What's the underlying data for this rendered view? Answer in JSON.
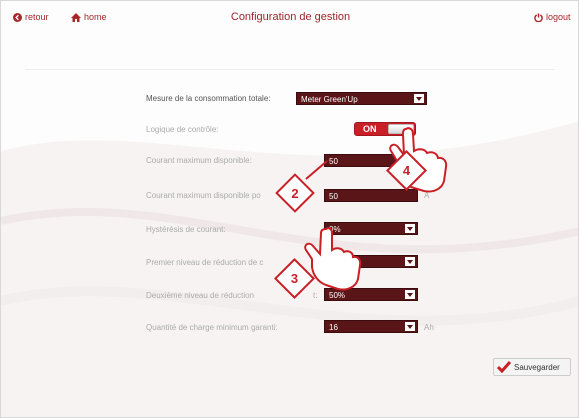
{
  "header": {
    "back_label": "retour",
    "home_label": "home",
    "title": "Configuration de gestion",
    "logout_label": "logout"
  },
  "form": {
    "rows": [
      {
        "label": "Mesure de la consommation totale:",
        "value": "Meter Green'Up",
        "unit": ""
      },
      {
        "label": "Logique de contrôle:",
        "value": "ON",
        "unit": ""
      },
      {
        "label": "Courant maximum disponible:",
        "value": "50",
        "unit": "A"
      },
      {
        "label": "Courant maximum disponible po",
        "value": "50",
        "unit": "A"
      },
      {
        "label": "Hystérésis de courant:",
        "value": "0%",
        "unit": ""
      },
      {
        "label": "Premier niveau de réduction de c",
        "value": "75%",
        "unit": ""
      },
      {
        "label": "Deuxième niveau de réduction",
        "label_tail": "t:",
        "value": "50%",
        "unit": ""
      },
      {
        "label": "Quantité de charge minimum garanti:",
        "value": "16",
        "unit": "Ah"
      }
    ],
    "save_label": "Sauvegarder"
  },
  "callouts": [
    "2",
    "3",
    "4"
  ],
  "colors": {
    "accent": "#9c2528",
    "field_bg": "#5a1518",
    "toggle_on": "#c92027"
  }
}
